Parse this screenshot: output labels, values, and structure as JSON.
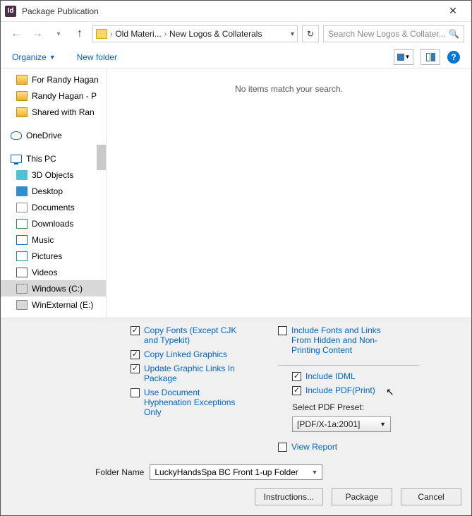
{
  "titlebar": {
    "title": "Package Publication"
  },
  "breadcrumb": {
    "crumb1": "Old Materi...",
    "crumb2": "New Logos & Collaterals"
  },
  "search": {
    "placeholder": "Search New Logos & Collater..."
  },
  "toolbar": {
    "organize": "Organize",
    "newfolder": "New folder"
  },
  "tree": {
    "items": [
      {
        "label": "For Randy Hagan",
        "icon": "ico-shared",
        "lvl": 1
      },
      {
        "label": "Randy Hagan - P",
        "icon": "ico-shared",
        "lvl": 1
      },
      {
        "label": "Shared with Ran",
        "icon": "ico-shared",
        "lvl": 1
      },
      {
        "label": "OneDrive",
        "icon": "ico-cloud",
        "lvl": 0
      },
      {
        "label": "This PC",
        "icon": "ico-pc",
        "lvl": 0
      },
      {
        "label": "3D Objects",
        "icon": "ico-3d",
        "lvl": 1
      },
      {
        "label": "Desktop",
        "icon": "ico-desktop",
        "lvl": 1
      },
      {
        "label": "Documents",
        "icon": "ico-docs",
        "lvl": 1
      },
      {
        "label": "Downloads",
        "icon": "ico-down",
        "lvl": 1
      },
      {
        "label": "Music",
        "icon": "ico-music",
        "lvl": 1
      },
      {
        "label": "Pictures",
        "icon": "ico-pics",
        "lvl": 1
      },
      {
        "label": "Videos",
        "icon": "ico-vids",
        "lvl": 1
      },
      {
        "label": "Windows (C:)",
        "icon": "ico-drive",
        "lvl": 1,
        "selected": true
      },
      {
        "label": "WinExternal (E:)",
        "icon": "ico-drive",
        "lvl": 1
      }
    ]
  },
  "content": {
    "empty_msg": "No items match your search."
  },
  "options": {
    "left": [
      {
        "label": "Copy Fonts (Except CJK and Typekit)",
        "checked": true
      },
      {
        "label": "Copy Linked Graphics",
        "checked": true
      },
      {
        "label": "Update Graphic Links In Package",
        "checked": true
      },
      {
        "label": "Use Document Hyphenation Exceptions Only",
        "checked": false
      }
    ],
    "right_top": {
      "label": "Include Fonts and Links From Hidden and Non-Printing Content",
      "checked": false
    },
    "include_idml": {
      "label": "Include IDML",
      "checked": true
    },
    "include_pdf": {
      "label": "Include PDF(Print)",
      "checked": true
    },
    "preset_label": "Select PDF Preset:",
    "preset_value": "[PDF/X-1a:2001]",
    "view_report": {
      "label": "View Report",
      "checked": false
    }
  },
  "folder": {
    "label": "Folder Name",
    "value": "LuckyHandsSpa BC Front 1-up Folder"
  },
  "buttons": {
    "instructions": "Instructions...",
    "package": "Package",
    "cancel": "Cancel"
  }
}
